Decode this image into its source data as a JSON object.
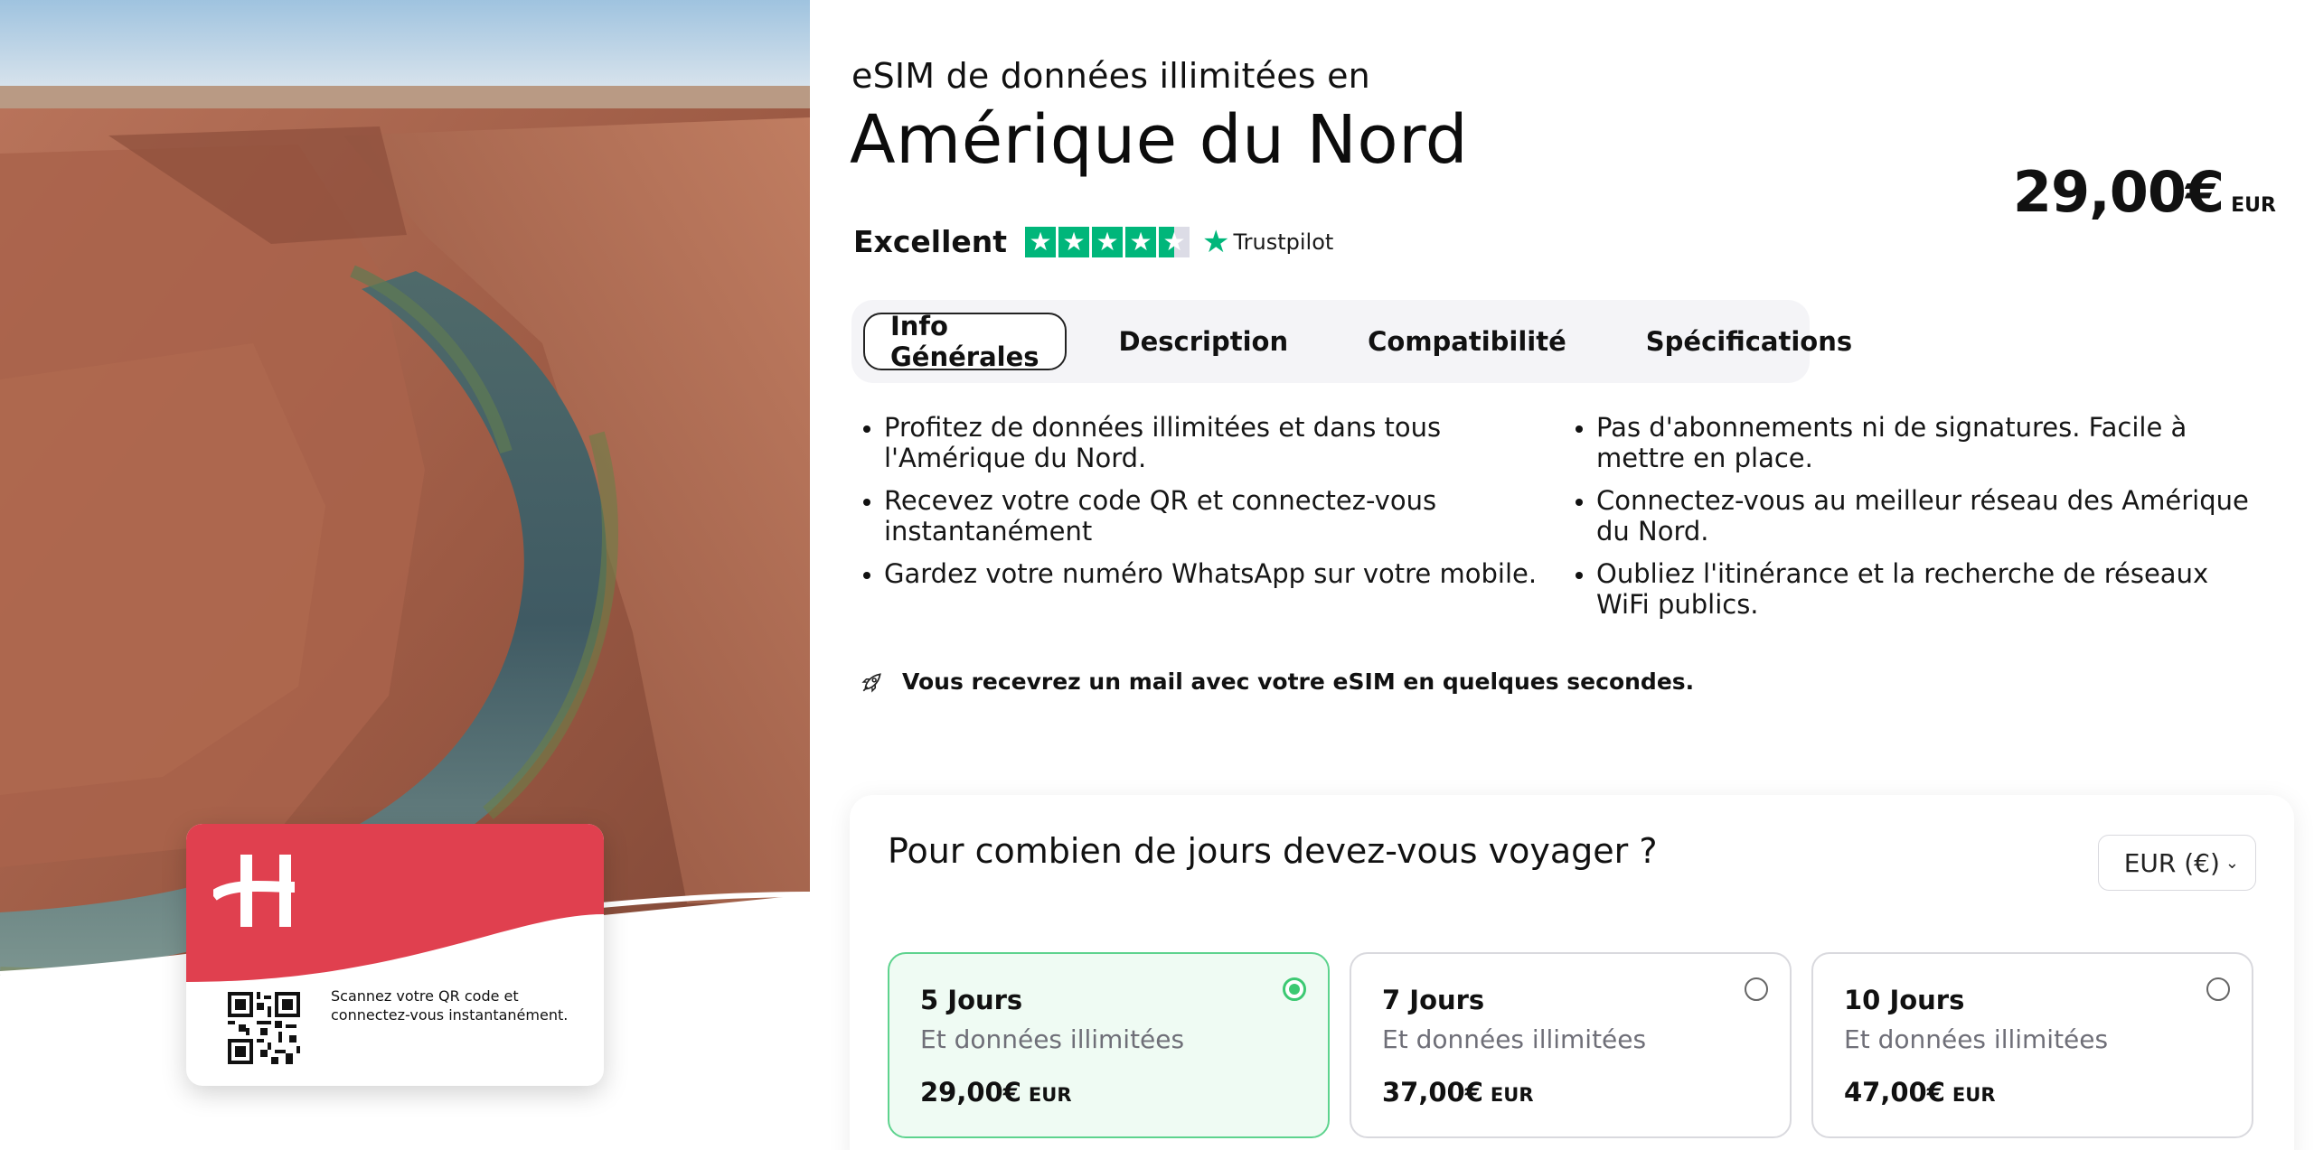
{
  "hero": {
    "image_alt": "canyon-river-photo",
    "card": {
      "logo_icon": "holafly-h-logo-icon",
      "qr_icon": "qr-code-icon",
      "text": "Scannez votre QR code et connectez-vous instantanément.",
      "brand_color": "#e0404f"
    }
  },
  "product": {
    "subtitle": "eSIM de données illimitées en",
    "title": "Amérique du Nord",
    "price": "29,00€",
    "currency": "EUR"
  },
  "rating": {
    "label": "Excellent",
    "stars": 4.5,
    "provider": "Trustpilot",
    "star_color": "#00b67a"
  },
  "tabs": [
    {
      "label": "Info Générales",
      "active": true
    },
    {
      "label": "Description",
      "active": false
    },
    {
      "label": "Compatibilité",
      "active": false
    },
    {
      "label": "Spécifications",
      "active": false
    }
  ],
  "bullets": {
    "left": [
      "Profitez de données illimitées et dans tous l'Amérique du Nord.",
      "Recevez votre code QR et connectez-vous instantanément",
      "Gardez votre numéro WhatsApp sur votre mobile."
    ],
    "right": [
      "Pas d'abonnements ni de signatures. Facile à mettre en place.",
      "Connectez-vous au meilleur réseau des Amérique du Nord.",
      "Oubliez l'itinérance et la recherche de réseaux WiFi publics."
    ]
  },
  "notice": {
    "icon": "rocket-icon",
    "text": "Vous recevrez un mail avec votre eSIM en quelques secondes."
  },
  "duration": {
    "question": "Pour combien de jours devez-vous voyager ?",
    "currency_select": "EUR (€)",
    "selected_color": "#3cc972",
    "options": [
      {
        "days": "5 Jours",
        "sub": "Et données illimitées",
        "price": "29,00€",
        "currency": "EUR",
        "selected": true
      },
      {
        "days": "7 Jours",
        "sub": "Et données illimitées",
        "price": "37,00€",
        "currency": "EUR",
        "selected": false
      },
      {
        "days": "10 Jours",
        "sub": "Et données illimitées",
        "price": "47,00€",
        "currency": "EUR",
        "selected": false
      }
    ]
  }
}
